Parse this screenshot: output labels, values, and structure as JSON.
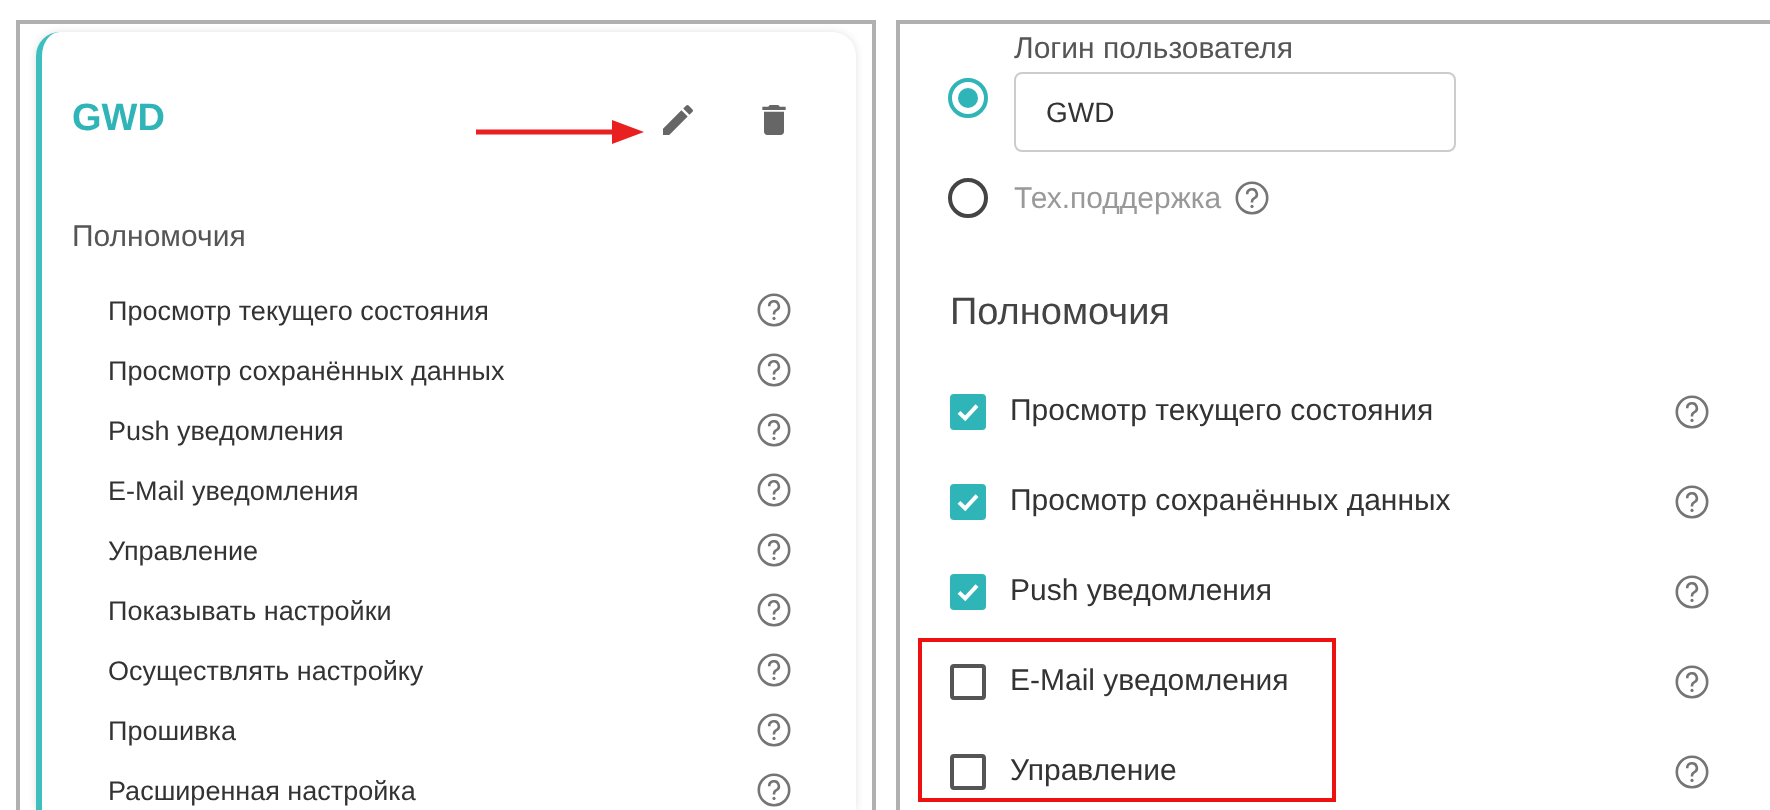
{
  "left_card": {
    "title": "GWD",
    "edit_pointed": true,
    "section_title": "Полномочия",
    "permissions": [
      {
        "label": "Просмотр текущего состояния"
      },
      {
        "label": "Просмотр сохранённых данных"
      },
      {
        "label": "Push уведомления"
      },
      {
        "label": "E-Mail уведомления"
      },
      {
        "label": "Управление"
      },
      {
        "label": "Показывать настройки"
      },
      {
        "label": "Осуществлять настройку"
      },
      {
        "label": "Прошивка"
      },
      {
        "label": "Расширенная настройка"
      }
    ]
  },
  "right_form": {
    "user_types": [
      {
        "kind": "login",
        "label": "Логин пользователя",
        "value": "GWD",
        "selected": true
      },
      {
        "kind": "support",
        "label": "Тех.поддержка",
        "selected": false
      }
    ],
    "section_title": "Полномочия",
    "permissions": [
      {
        "label": "Просмотр текущего состояния",
        "checked": true,
        "highlighted": false
      },
      {
        "label": "Просмотр сохранённых данных",
        "checked": true,
        "highlighted": false
      },
      {
        "label": "Push уведомления",
        "checked": true,
        "highlighted": false
      },
      {
        "label": "E-Mail уведомления",
        "checked": false,
        "highlighted": true
      },
      {
        "label": "Управление",
        "checked": false,
        "highlighted": true
      }
    ]
  }
}
